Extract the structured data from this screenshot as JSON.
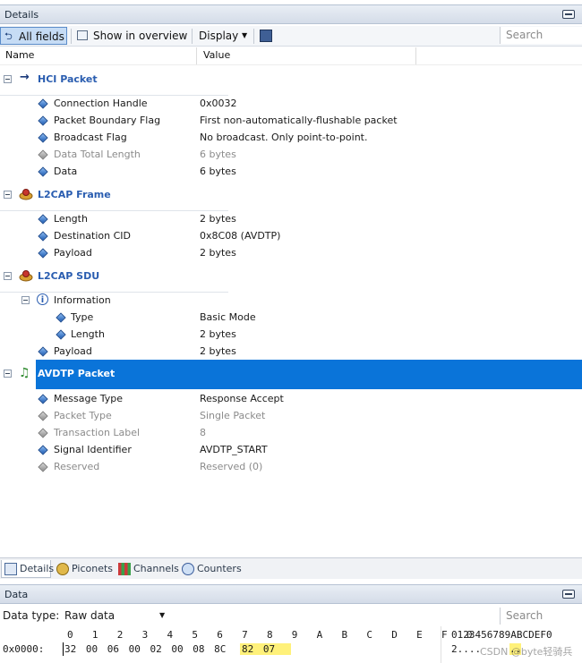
{
  "details_panel": {
    "title": "Details"
  },
  "toolbar": {
    "all_fields": "All fields",
    "show_in_overview": "Show in overview",
    "display": "Display",
    "search_placeholder": "Search"
  },
  "columns": {
    "name": "Name",
    "value": "Value"
  },
  "sections": [
    {
      "label": "HCI Packet",
      "rows": [
        {
          "name": "Connection Handle",
          "value": "0x0032"
        },
        {
          "name": "Packet Boundary Flag",
          "value": "First non-automatically-flushable packet"
        },
        {
          "name": "Broadcast Flag",
          "value": "No broadcast. Only point-to-point."
        },
        {
          "name": "Data Total Length",
          "value": "6 bytes"
        },
        {
          "name": "Data",
          "value": "6 bytes"
        }
      ]
    },
    {
      "label": "L2CAP Frame",
      "rows": [
        {
          "name": "Length",
          "value": "2 bytes"
        },
        {
          "name": "Destination CID",
          "value": "0x8C08 (AVDTP)"
        },
        {
          "name": "Payload",
          "value": "2 bytes"
        }
      ]
    },
    {
      "label": "L2CAP SDU",
      "rows": [
        {
          "name": "Information",
          "value": ""
        },
        {
          "name": "Type",
          "value": "Basic Mode"
        },
        {
          "name": "Length",
          "value": "2 bytes"
        },
        {
          "name": "Payload",
          "value": "2 bytes"
        }
      ]
    },
    {
      "label": "AVDTP Packet",
      "rows": [
        {
          "name": "Message Type",
          "value": "Response Accept"
        },
        {
          "name": "Packet Type",
          "value": "Single Packet"
        },
        {
          "name": "Transaction Label",
          "value": "8"
        },
        {
          "name": "Signal Identifier",
          "value": "AVDTP_START"
        },
        {
          "name": "Reserved",
          "value": "Reserved (0)"
        }
      ]
    }
  ],
  "tabs": [
    {
      "label": "Details"
    },
    {
      "label": "Piconets"
    },
    {
      "label": "Channels"
    },
    {
      "label": "Counters"
    }
  ],
  "data_panel": {
    "title": "Data",
    "data_type_label": "Data type:",
    "data_type_value": "Raw data",
    "search_placeholder": "Search",
    "hex_header": "0  1  2  3  4  5  6  7  8  9  A  B  C  D  E  F  0",
    "ascii_header": "0123456789ABCDEF0",
    "offset": "0x0000:",
    "bytes_plain": "32 00 06 00 02 00 08 8C",
    "bytes_highlight": "82 07",
    "ascii_plain": "2....",
    "ascii_highlight": "..",
    "watermark": "CSDN @byte轻骑兵"
  },
  "colors": {
    "selection": "#0a74d9",
    "section_text": "#2a5db0",
    "highlight": "#fff17a"
  }
}
